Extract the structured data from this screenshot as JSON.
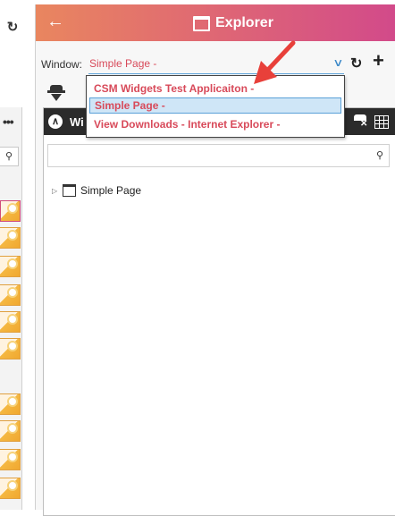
{
  "panel": {
    "title": "Explorer",
    "back_icon": "arrow-left-icon",
    "window_icon": "window-icon"
  },
  "window_selector": {
    "label": "Window:",
    "value": "Simple Page -",
    "options": [
      {
        "label": "CSM Widgets Test Applicaiton -"
      },
      {
        "label": "Simple Page -",
        "selected": true
      },
      {
        "label": "View Downloads - Internet Explorer -"
      }
    ]
  },
  "toolbar": {
    "sync_icon": "sync-icon",
    "add_label": "+",
    "spy_icon": "spy-icon"
  },
  "tree_pane": {
    "title": "Wi",
    "search_placeholder": "",
    "items": [
      {
        "label": "Simple Page"
      }
    ]
  },
  "left_strip": {
    "more_label": "•••"
  },
  "colors": {
    "header_gradient_start": "#e9865f",
    "header_gradient_end": "#d24a8a",
    "accent_text": "#d84a5a",
    "selection_bg": "#cfe6f7",
    "annotation_arrow": "#e8403a"
  }
}
